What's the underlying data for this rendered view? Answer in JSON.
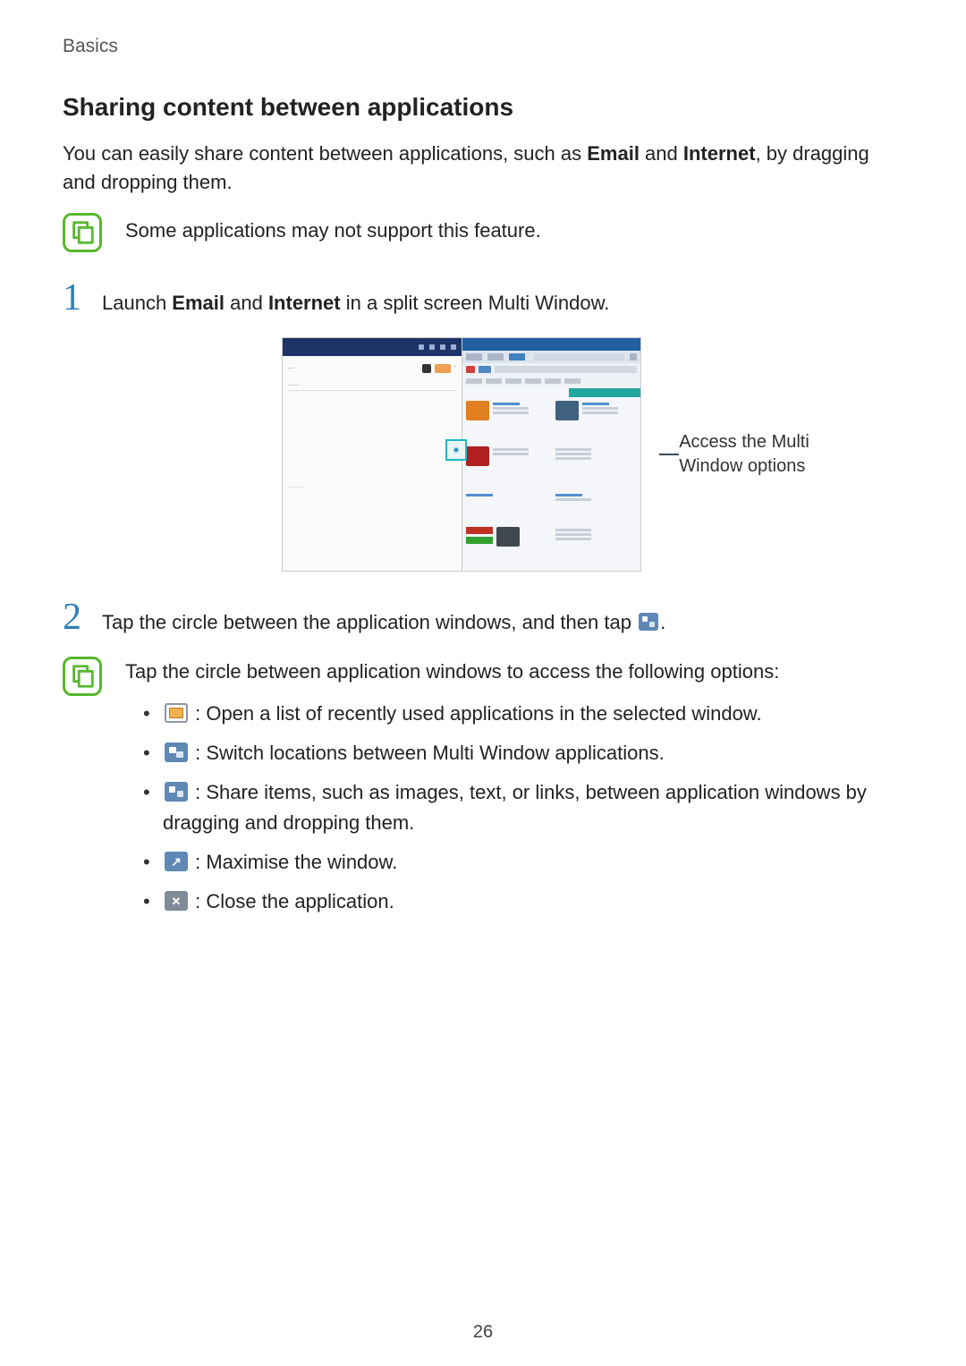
{
  "sectionLabel": "Basics",
  "heading": "Sharing content between applications",
  "intro": {
    "pre": "You can easily share content between applications, such as ",
    "bold1": "Email",
    "mid": " and ",
    "bold2": "Internet",
    "post": ", by dragging and dropping them."
  },
  "note1": "Some applications may not support this feature.",
  "step1": {
    "num": "1",
    "pre": "Launch ",
    "bold1": "Email",
    "mid": " and ",
    "bold2": "Internet",
    "post": " in a split screen Multi Window."
  },
  "callout": {
    "line1": "Access the Multi",
    "line2": "Window options"
  },
  "step2": {
    "num": "2",
    "pre": "Tap the circle between the application windows, and then tap ",
    "post": "."
  },
  "note2": {
    "intro": "Tap the circle between application windows to access the following options:",
    "items": {
      "recent": " : Open a list of recently used applications in the selected window.",
      "switch": " : Switch locations between Multi Window applications.",
      "share": " : Share items, such as images, text, or links, between application windows by dragging and dropping them.",
      "max": " : Maximise the window.",
      "close": " : Close the application."
    }
  },
  "pageNumber": "26"
}
